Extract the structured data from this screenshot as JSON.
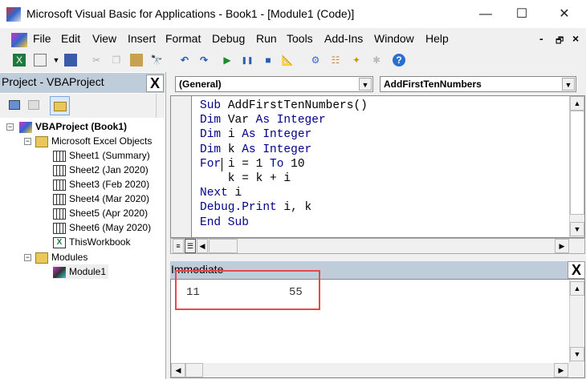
{
  "window": {
    "title": "Microsoft Visual Basic for Applications - Book1 - [Module1 (Code)]",
    "minimize": "—",
    "maximize": "☐",
    "close": "✕"
  },
  "menu": [
    "File",
    "Edit",
    "View",
    "Insert",
    "Format",
    "Debug",
    "Run",
    "Tools",
    "Add-Ins",
    "Window",
    "Help"
  ],
  "mdi_controls": {
    "minimize": "-",
    "restore": "🗗",
    "close": "×"
  },
  "project": {
    "title": "Project - VBAProject",
    "close": "X",
    "root": "VBAProject (Book1)",
    "folder1": "Microsoft Excel Objects",
    "sheets": [
      "Sheet1 (Summary)",
      "Sheet2 (Jan 2020)",
      "Sheet3 (Feb 2020)",
      "Sheet4 (Mar 2020)",
      "Sheet5 (Apr 2020)",
      "Sheet6 (May 2020)"
    ],
    "workbook": "ThisWorkbook",
    "folder2": "Modules",
    "module": "Module1"
  },
  "code": {
    "object_dropdown": "(General)",
    "proc_dropdown": "AddFirstTenNumbers",
    "lines": [
      [
        [
          "kw",
          "Sub "
        ],
        [
          "",
          "AddFirstTenNumbers()"
        ]
      ],
      [
        [
          "kw",
          "Dim "
        ],
        [
          "",
          "Var "
        ],
        [
          "kw",
          "As Integer"
        ]
      ],
      [
        [
          "kw",
          "Dim "
        ],
        [
          "",
          "i "
        ],
        [
          "kw",
          "As Integer"
        ]
      ],
      [
        [
          "kw",
          "Dim "
        ],
        [
          "",
          "k "
        ],
        [
          "kw",
          "As Integer"
        ]
      ],
      [
        [
          "kw",
          "For "
        ],
        [
          "",
          "i = 1 "
        ],
        [
          "kw",
          "To "
        ],
        [
          "",
          "10"
        ]
      ],
      [
        [
          "",
          "    k = k + i"
        ]
      ],
      [
        [
          "kw",
          "Next "
        ],
        [
          "",
          "i"
        ]
      ],
      [
        [
          "kw",
          "Debug.Print "
        ],
        [
          "",
          "i, k"
        ]
      ],
      [
        [
          "kw",
          "End Sub"
        ]
      ]
    ]
  },
  "immediate": {
    "title": "Immediate",
    "close": "X",
    "output": [
      "11",
      "55"
    ]
  }
}
